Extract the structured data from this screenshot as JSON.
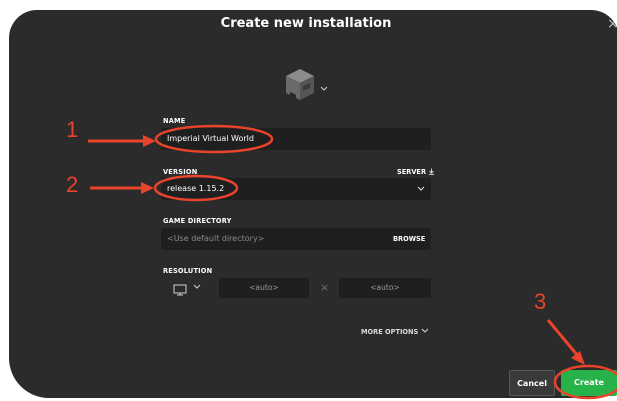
{
  "dialog": {
    "title": "Create new installation",
    "close_symbol": "×"
  },
  "name_field": {
    "label": "NAME",
    "value": "Imperial Virtual World"
  },
  "version_field": {
    "label": "VERSION",
    "server_link": "SERVER",
    "value": "release 1.15.2"
  },
  "game_directory": {
    "label": "GAME DIRECTORY",
    "placeholder": "<Use default directory>",
    "browse_label": "BROWSE"
  },
  "resolution": {
    "label": "RESOLUTION",
    "width_placeholder": "<auto>",
    "separator": "×",
    "height_placeholder": "<auto>"
  },
  "more_options_label": "MORE OPTIONS",
  "buttons": {
    "cancel_label": "Cancel",
    "create_label": "Create"
  },
  "annotations": {
    "step1": "1",
    "step2": "2",
    "step3": "3",
    "color": "#e8432b"
  },
  "icons": {
    "installation_icon": "furnace-block-icon",
    "dropdown": "chevron-down-icon",
    "server_download": "download-icon",
    "monitor": "monitor-icon"
  },
  "colors": {
    "dialog_bg": "#2b2b2b",
    "field_bg": "#1f1f1f",
    "create_green": "#27b24a",
    "annotation_red": "#e8432b"
  }
}
